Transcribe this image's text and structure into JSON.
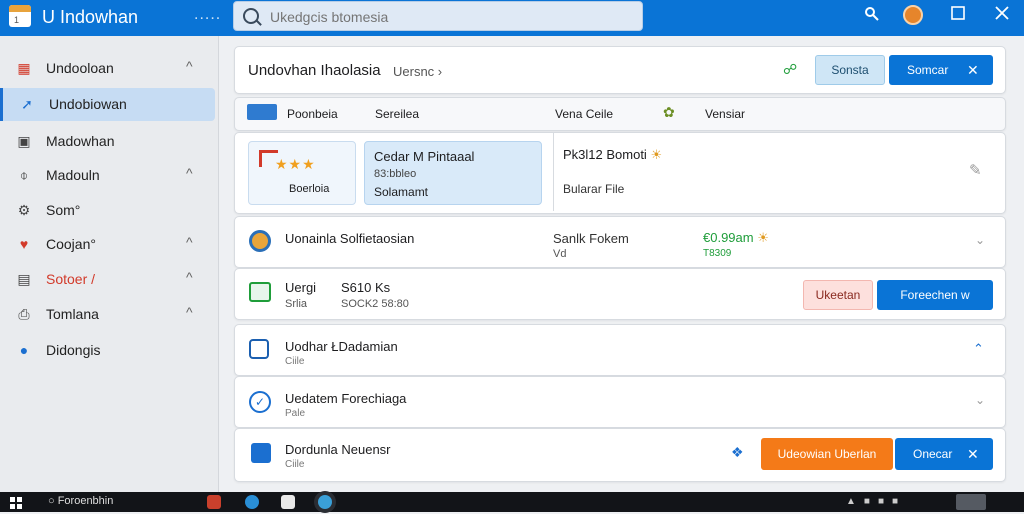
{
  "window": {
    "logo_text": "1",
    "title": "U Indowhan",
    "dots": ".....",
    "search_placeholder": "Ukedgcis btomesia"
  },
  "titlebar_icons": [
    "key-icon",
    "avatar-icon",
    "maximize-icon",
    "close-icon"
  ],
  "sidebar": {
    "items": [
      {
        "label": "Undooloan",
        "icon": "grid-icon",
        "chevron": "^"
      },
      {
        "label": "Undobiowan",
        "icon": "pin-icon",
        "chevron": ""
      },
      {
        "label": "Madowhan",
        "icon": "lock-icon",
        "chevron": ""
      },
      {
        "label": "Madouln",
        "icon": "download-icon",
        "chevron": "^"
      },
      {
        "label": "Som°",
        "icon": "gear-icon",
        "chevron": ""
      },
      {
        "label": "Coojan°",
        "icon": "heart-icon",
        "chevron": "^"
      },
      {
        "label": "Sotoer /",
        "icon": "bag-icon",
        "chevron": "^"
      },
      {
        "label": "Tomlana",
        "icon": "printer-icon",
        "chevron": "^"
      },
      {
        "label": "Didongis",
        "icon": "chat-icon",
        "chevron": ""
      }
    ]
  },
  "header_card": {
    "title": "Undovhan Ihaolasia",
    "breadcrumb": "Uersnc",
    "light_button": "Sonsta",
    "primary_button": "Somcar"
  },
  "tabs": {
    "col1": "Poonbeia",
    "col2": "Sereilea",
    "col3": "Vena Ceile",
    "col4": "Vensiar"
  },
  "feature_card": {
    "rating_label": "Boerloia",
    "tile_title": "Cedar M Pintaaal",
    "tile_sub1": "83:bbleo",
    "tile_sub2": "Solamamt",
    "info_title": "Pk3l12 Bomoti",
    "info_sub": "Bularar File"
  },
  "rows": [
    {
      "title": "Uonainla Solfietaosian",
      "mid1": "Sanlk Fokem",
      "mid2": "Vd",
      "amount": "€0.99am",
      "amount_sub": "T8309"
    },
    {
      "title": "Uergi",
      "value": "S610 Ks",
      "sub1": "Srlia",
      "sub2": "SOCK2 58:80",
      "pink_button": "Ukeetan",
      "primary_button": "Foreechen w"
    },
    {
      "title": "Uodhar ŁDadamian",
      "sub": "Ciile"
    },
    {
      "title": "Uedatem Forechiaga",
      "sub": "Pale"
    },
    {
      "title": "Dordunla Neuensr",
      "sub": "Ciile",
      "orange_button": "Udeowian Uberlan",
      "primary_button": "Onecar"
    }
  ],
  "taskbar": {
    "search_label": "Foroenbhin"
  },
  "colors": {
    "primary": "#0a74d6",
    "orange": "#f47a18",
    "green": "#1f9d3a"
  }
}
